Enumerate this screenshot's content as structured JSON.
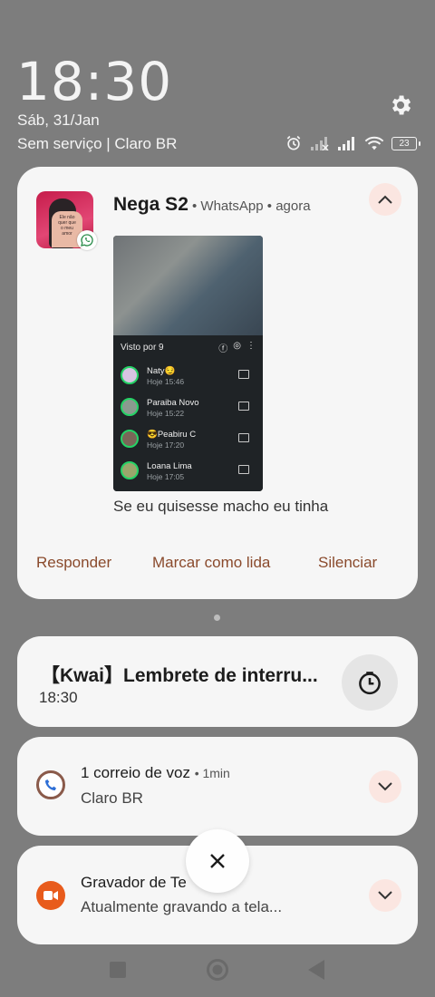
{
  "status": {
    "time": "18:30",
    "date": "Sáb, 31/Jan",
    "carrier": "Sem serviço | Claro BR",
    "battery": "23"
  },
  "whatsapp": {
    "sender": "Nega S2",
    "meta": "• WhatsApp • agora",
    "message": "Se eu quisesse macho eu tinha",
    "preview": {
      "seen_by": "Visto por 9",
      "viewers": [
        {
          "name": "Naty😏",
          "time": "Hoje 15:46"
        },
        {
          "name": "Paraiba Novo",
          "time": "Hoje 15:22"
        },
        {
          "name": "😎Peabiru C",
          "time": "Hoje 17:20"
        },
        {
          "name": "Loana Lima",
          "time": "Hoje 17:05"
        }
      ]
    },
    "actions": {
      "reply": "Responder",
      "mark_read": "Marcar como lida",
      "mute": "Silenciar"
    },
    "accent": "#8a4a2c"
  },
  "kwai": {
    "title": "【Kwai】Lembrete de interru...",
    "time": "18:30"
  },
  "voicemail": {
    "title": "1 correio de voz",
    "meta": "• 1min",
    "subtitle": "Claro BR"
  },
  "recorder": {
    "title": "Gravador de Te",
    "subtitle": "Atualmente gravando a tela..."
  },
  "icons": {
    "settings": "gear-icon",
    "dismiss": "close-icon",
    "snooze": "clock-icon",
    "expand": "chevron-icon"
  }
}
